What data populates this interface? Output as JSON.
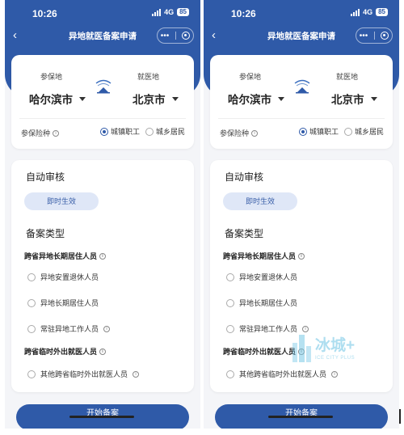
{
  "screens": [
    {
      "status_time": "10:26",
      "network": "4G",
      "battery": "85",
      "title": "异地就医备案申请",
      "back_icon": "chevron-left-icon",
      "insured_place_label": "参保地",
      "insured_place_value": "哈尔滨市",
      "medical_place_label": "就医地",
      "medical_place_value": "北京市",
      "insurance_type_label": "参保险种",
      "insurance_options": [
        {
          "label": "城镇职工",
          "checked": true
        },
        {
          "label": "城乡居民",
          "checked": false
        }
      ],
      "auto_review_title": "自动审核",
      "auto_review_badge": "即时生效",
      "filing_type_title": "备案类型",
      "group1_title": "跨省异地长期居住人员",
      "group1_options": [
        "异地安置退休人员",
        "异地长期居住人员",
        "常驻异地工作人员"
      ],
      "group2_title": "跨省临时外出就医人员",
      "group2_options": [
        "其他跨省临时外出就医人员"
      ],
      "start_button": "开始备案"
    },
    {
      "status_time": "10:26",
      "network": "4G",
      "battery": "85",
      "title": "异地就医备案申请",
      "back_icon": "chevron-left-icon",
      "insured_place_label": "参保地",
      "insured_place_value": "哈尔滨市",
      "medical_place_label": "就医地",
      "medical_place_value": "北京市",
      "insurance_type_label": "参保险种",
      "insurance_options": [
        {
          "label": "城镇职工",
          "checked": true
        },
        {
          "label": "城乡居民",
          "checked": false
        }
      ],
      "auto_review_title": "自动审核",
      "auto_review_badge": "即时生效",
      "filing_type_title": "备案类型",
      "group1_title": "跨省异地长期居住人员",
      "group1_options": [
        "异地安置退休人员",
        "异地长期居住人员",
        "常驻异地工作人员"
      ],
      "group2_title": "跨省临时外出就医人员",
      "group2_options": [
        "其他跨省临时外出就医人员"
      ],
      "start_button": "开始备案",
      "watermark": {
        "text": "冰城+",
        "sub": "ICE CITY PLUS"
      }
    }
  ],
  "colors": {
    "primary": "#2f5aa8",
    "badge_bg": "#dfe7f7",
    "page_bg": "#f4f5f8"
  }
}
